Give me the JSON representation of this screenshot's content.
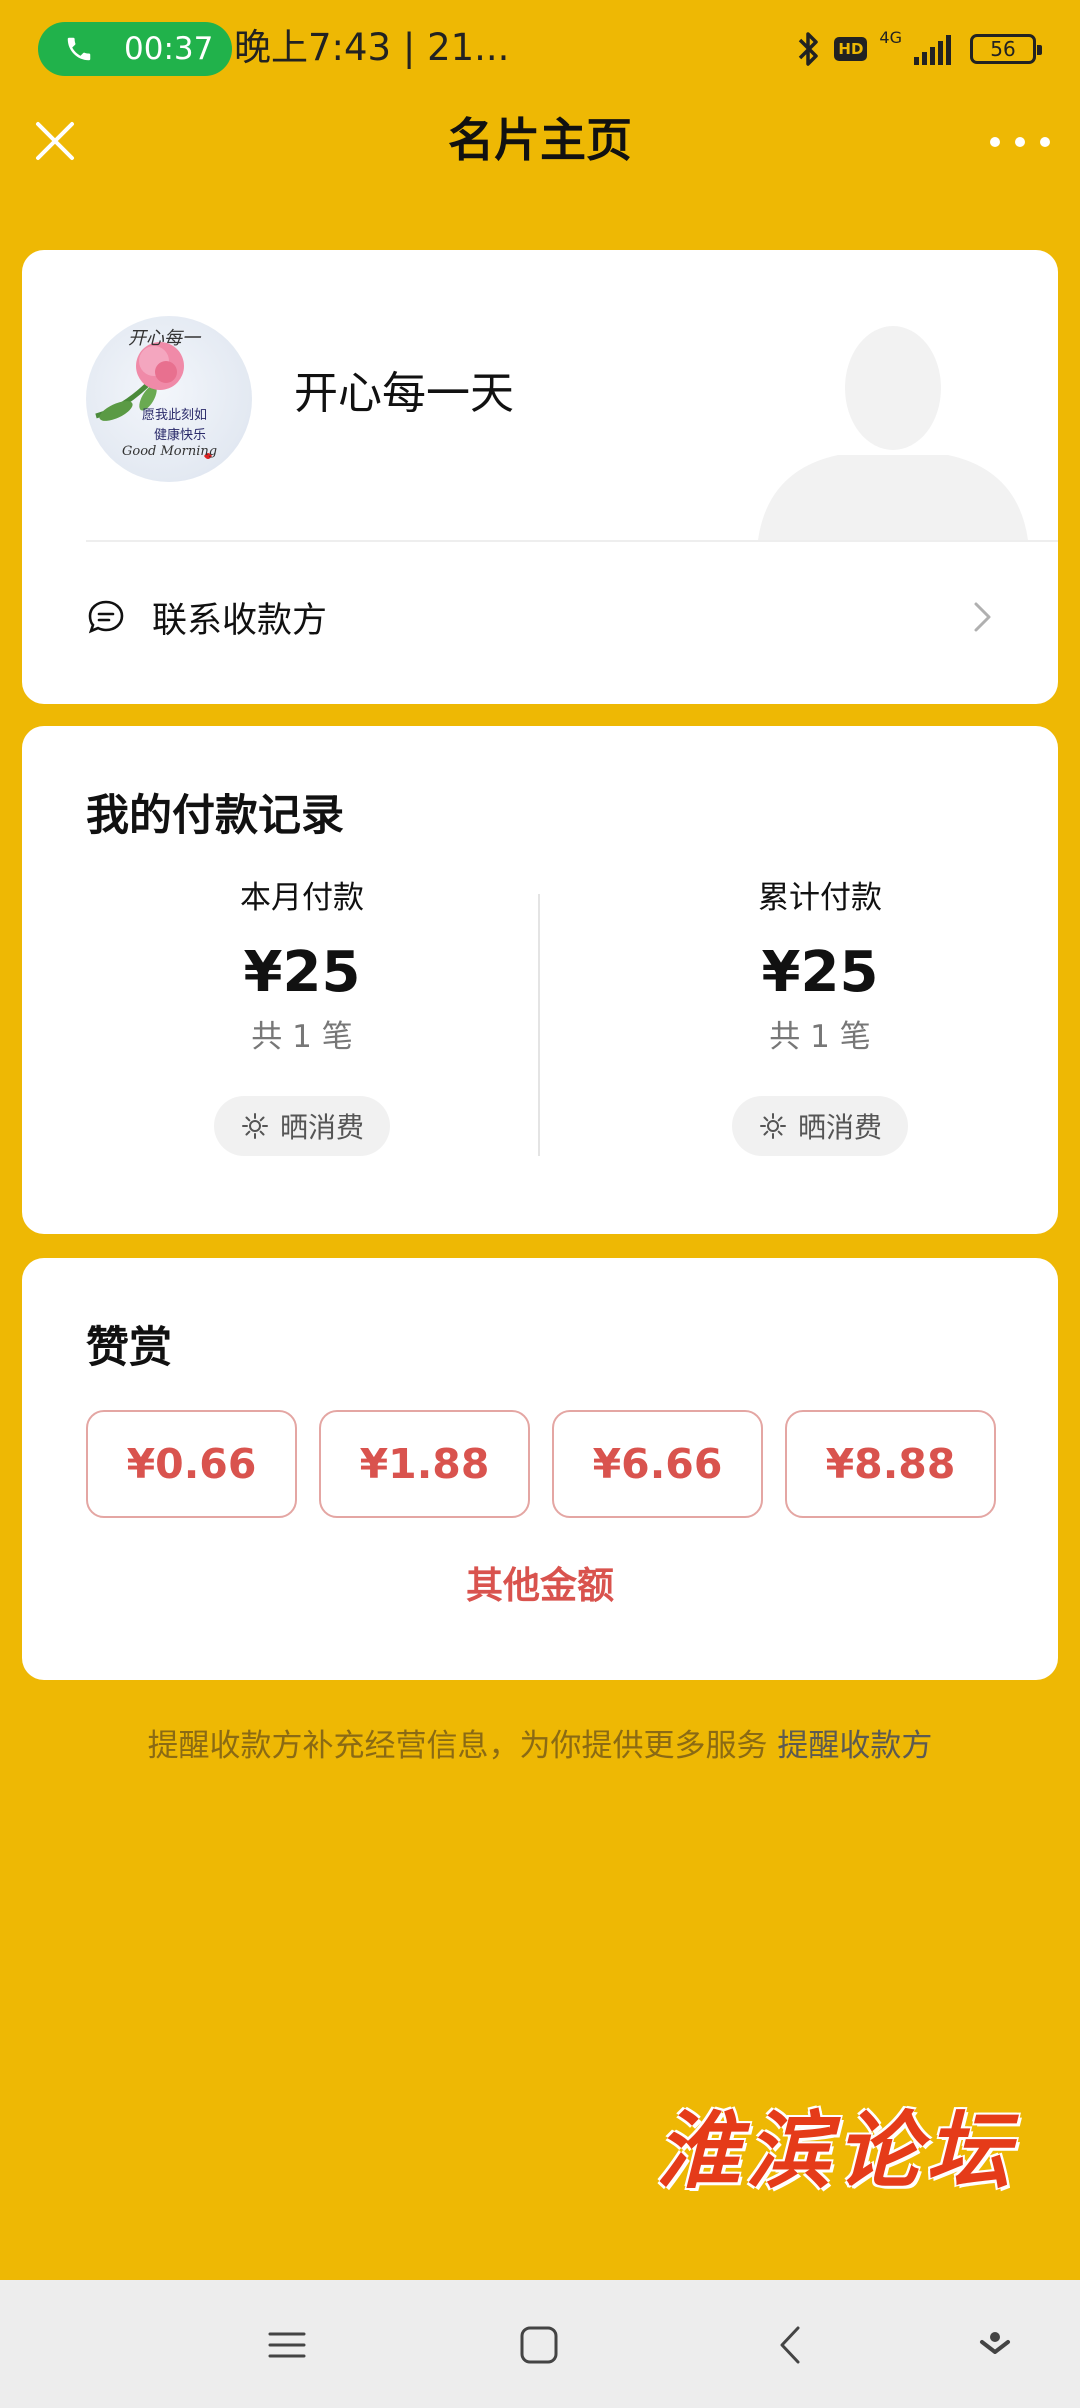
{
  "status_bar": {
    "call_timer": "00:37",
    "time": "晚上7:43 | 21...",
    "hd": "HD",
    "network": "4G",
    "battery": "56"
  },
  "header": {
    "title": "名片主页"
  },
  "profile": {
    "name": "开心每一天",
    "avatar_text": [
      "开心每一",
      "愿我此刻如",
      "健康快乐",
      "Good Morning"
    ],
    "contact_label": "联系收款方"
  },
  "records": {
    "title": "我的付款记录",
    "month": {
      "label": "本月付款",
      "amount": "¥25",
      "count": "共 1 笔",
      "share_label": "晒消费"
    },
    "total": {
      "label": "累计付款",
      "amount": "¥25",
      "count": "共 1 笔",
      "share_label": "晒消费"
    }
  },
  "reward": {
    "title": "赞赏",
    "amounts": [
      "¥0.66",
      "¥1.88",
      "¥6.66",
      "¥8.88"
    ],
    "other_label": "其他金额"
  },
  "hint": {
    "text": "提醒收款方补充经营信息，为你提供更多服务",
    "link": "提醒收款方"
  },
  "watermark": "淮滨论坛",
  "colors": {
    "background": "#EEB804",
    "accent_red": "#D9534E",
    "call_green": "#21B24B"
  }
}
